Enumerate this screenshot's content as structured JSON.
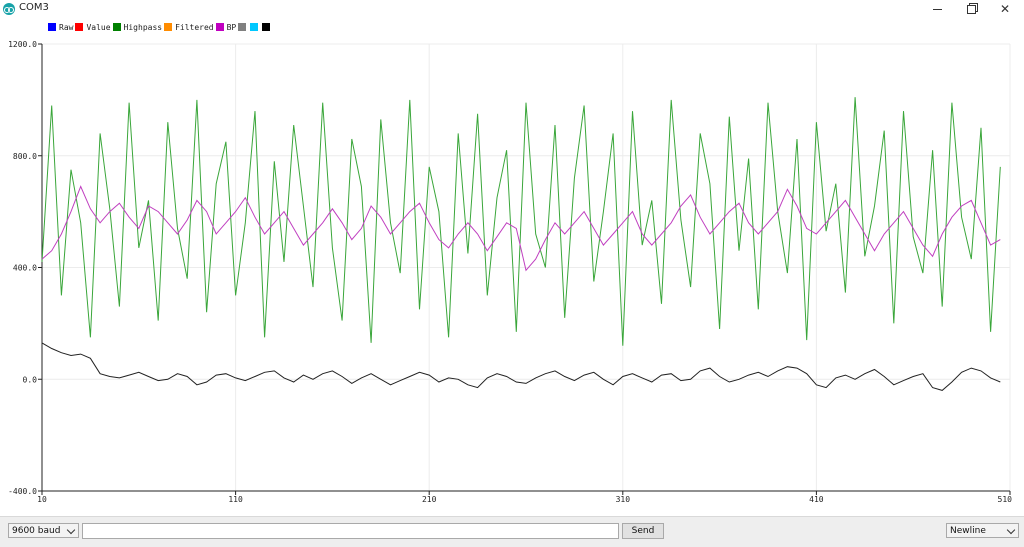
{
  "window": {
    "title": "COM3",
    "icon": "arduino-icon",
    "controls": [
      "minimize-icon",
      "maximize-icon",
      "close-icon"
    ]
  },
  "legend": [
    {
      "label": "Raw",
      "color": "#0000ff"
    },
    {
      "label": "Value",
      "color": "#ff0000"
    },
    {
      "label": "Highpass",
      "color": "#008000"
    },
    {
      "label": "Filtered",
      "color": "#ff8c00"
    },
    {
      "label": "BP",
      "color": "#c000c0"
    },
    {
      "label": "",
      "color": "#808080"
    },
    {
      "label": "",
      "color": "#00c8ff"
    },
    {
      "label": "",
      "color": "#000000"
    }
  ],
  "chart_data": {
    "type": "line",
    "xlim": [
      10,
      510
    ],
    "ylim": [
      -400,
      1200
    ],
    "x_ticks": [
      "10",
      "110",
      "210",
      "310",
      "410",
      "510"
    ],
    "y_ticks": [
      "1200.0",
      "800.0",
      "400.0",
      "0.0",
      "-400.0"
    ],
    "grid": true,
    "legend_position": "top-left",
    "series": [
      {
        "name": "Highpass",
        "color": "#3aa63a",
        "sample_every": 5,
        "values": [
          420,
          980,
          300,
          750,
          560,
          150,
          880,
          610,
          260,
          990,
          470,
          640,
          210,
          920,
          540,
          360,
          1000,
          240,
          700,
          850,
          300,
          560,
          960,
          150,
          780,
          420,
          910,
          620,
          330,
          990,
          470,
          210,
          860,
          690,
          130,
          930,
          560,
          380,
          1000,
          250,
          760,
          600,
          150,
          880,
          450,
          950,
          300,
          650,
          820,
          170,
          990,
          520,
          400,
          910,
          220,
          720,
          980,
          350,
          600,
          880,
          120,
          960,
          480,
          640,
          270,
          1000,
          570,
          330,
          880,
          700,
          180,
          940,
          460,
          790,
          250,
          990,
          600,
          380,
          860,
          140,
          920,
          530,
          700,
          310,
          1010,
          440,
          620,
          890,
          200,
          960,
          510,
          380,
          820,
          260,
          990,
          580,
          430,
          900,
          170,
          760
        ]
      },
      {
        "name": "BP",
        "color": "#c040c0",
        "sample_every": 5,
        "values": [
          430,
          460,
          520,
          600,
          690,
          610,
          560,
          600,
          630,
          580,
          540,
          620,
          600,
          560,
          520,
          570,
          640,
          600,
          520,
          560,
          600,
          650,
          580,
          520,
          560,
          600,
          540,
          480,
          520,
          560,
          610,
          560,
          500,
          540,
          620,
          580,
          520,
          560,
          600,
          630,
          560,
          500,
          470,
          520,
          560,
          520,
          460,
          510,
          560,
          540,
          390,
          430,
          500,
          560,
          520,
          560,
          600,
          540,
          480,
          520,
          560,
          600,
          520,
          480,
          520,
          560,
          620,
          660,
          580,
          520,
          560,
          600,
          630,
          560,
          520,
          560,
          600,
          680,
          620,
          540,
          520,
          560,
          600,
          640,
          580,
          520,
          460,
          520,
          560,
          600,
          540,
          480,
          440,
          520,
          580,
          620,
          640,
          560,
          480,
          500
        ]
      },
      {
        "name": "",
        "color": "#222222",
        "sample_every": 5,
        "values": [
          130,
          110,
          95,
          85,
          90,
          75,
          20,
          10,
          5,
          15,
          25,
          10,
          -5,
          0,
          20,
          10,
          -20,
          -10,
          15,
          20,
          5,
          -5,
          10,
          25,
          30,
          5,
          -10,
          15,
          0,
          20,
          30,
          10,
          -15,
          5,
          20,
          0,
          -20,
          -5,
          10,
          25,
          15,
          -10,
          5,
          0,
          -20,
          -30,
          5,
          20,
          10,
          -10,
          -15,
          5,
          20,
          30,
          10,
          -5,
          15,
          25,
          0,
          -20,
          10,
          20,
          5,
          -10,
          15,
          20,
          -5,
          0,
          30,
          40,
          10,
          -10,
          0,
          15,
          25,
          10,
          30,
          45,
          40,
          20,
          -20,
          -30,
          5,
          15,
          0,
          20,
          35,
          10,
          -20,
          -5,
          10,
          20,
          -30,
          -40,
          -10,
          25,
          40,
          30,
          5,
          -10
        ]
      }
    ]
  },
  "toolbar": {
    "baud": "9600 baud",
    "send_label": "Send",
    "line_ending": "Newline"
  }
}
